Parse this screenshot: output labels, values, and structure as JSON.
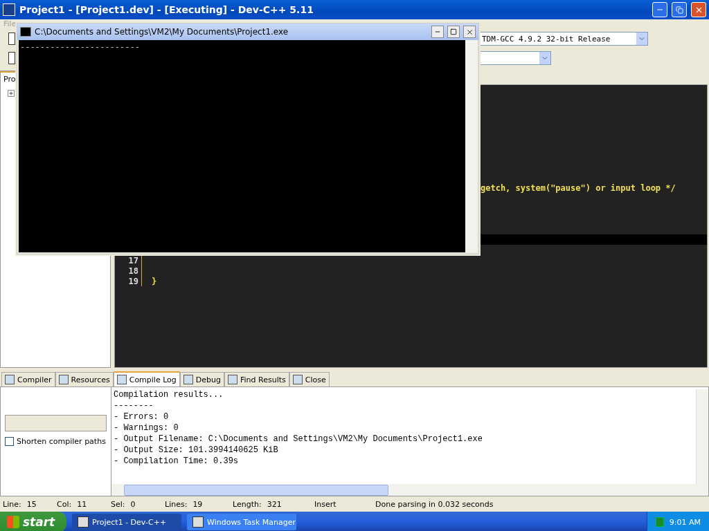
{
  "window": {
    "title": "Project1 - [Project1.dev] - [Executing] - Dev-C++ 5.11"
  },
  "menu": [
    "File"
  ],
  "toolbar": {
    "compiler_select": "TDM-GCC 4.9.2 32-bit Release"
  },
  "project_panel": {
    "tab": "Pro"
  },
  "editor": {
    "lines": [
      {
        "kind": "hidden"
      },
      {
        "kind": "hidden"
      },
      {
        "kind": "hidden"
      },
      {
        "kind": "hidden"
      },
      {
        "kind": "hidden"
      },
      {
        "kind": "hidden"
      },
      {
        "kind": "hidden"
      },
      {
        "kind": "hidden"
      },
      {
        "kind": "hidden"
      },
      {
        "kind": "covered",
        "code": "getch, system(\"pause\") or input loop */"
      },
      {
        "kind": "hidden"
      },
      {
        "kind": "hidden"
      },
      {
        "kind": "hidden"
      },
      {
        "kind": "hidden"
      },
      {
        "kind": "current"
      },
      {
        "kind": "hidden"
      },
      {
        "kind": "plain",
        "number": "17"
      },
      {
        "kind": "plain",
        "number": "18"
      },
      {
        "kind": "plain",
        "number": "19",
        "code": "}"
      }
    ]
  },
  "console": {
    "title": "C:\\Documents and Settings\\VM2\\My Documents\\Project1.exe",
    "output": "------------------------"
  },
  "bottom_tabs": [
    {
      "label": "Compiler",
      "selected": false
    },
    {
      "label": "Resources",
      "selected": false
    },
    {
      "label": "Compile Log",
      "selected": true
    },
    {
      "label": "Debug",
      "selected": false
    },
    {
      "label": "Find Results",
      "selected": false
    },
    {
      "label": "Close",
      "selected": false
    }
  ],
  "compile_log": {
    "shorten_paths": {
      "label": "Shorten compiler paths",
      "checked": false
    },
    "lines": [
      "Compilation results...",
      "--------",
      "- Errors: 0",
      "- Warnings: 0",
      "- Output Filename: C:\\Documents and Settings\\VM2\\My Documents\\Project1.exe",
      "- Output Size: 101.3994140625 KiB",
      "- Compilation Time: 0.39s"
    ]
  },
  "status_bar": [
    {
      "label": "Line:",
      "value": "15"
    },
    {
      "label": "Col:",
      "value": "11"
    },
    {
      "label": "Sel:",
      "value": "0"
    },
    {
      "label": "Lines:",
      "value": "19"
    },
    {
      "label": "Length:",
      "value": "321"
    },
    {
      "value": "Insert"
    },
    {
      "value": "Done parsing in 0.032 seconds"
    }
  ],
  "taskbar": {
    "start": "start",
    "tasks": [
      {
        "label": "Project1 - Dev-C++",
        "selected": true
      },
      {
        "label": "Windows Task Manager",
        "selected": false
      }
    ],
    "clock": "9:01 AM"
  }
}
